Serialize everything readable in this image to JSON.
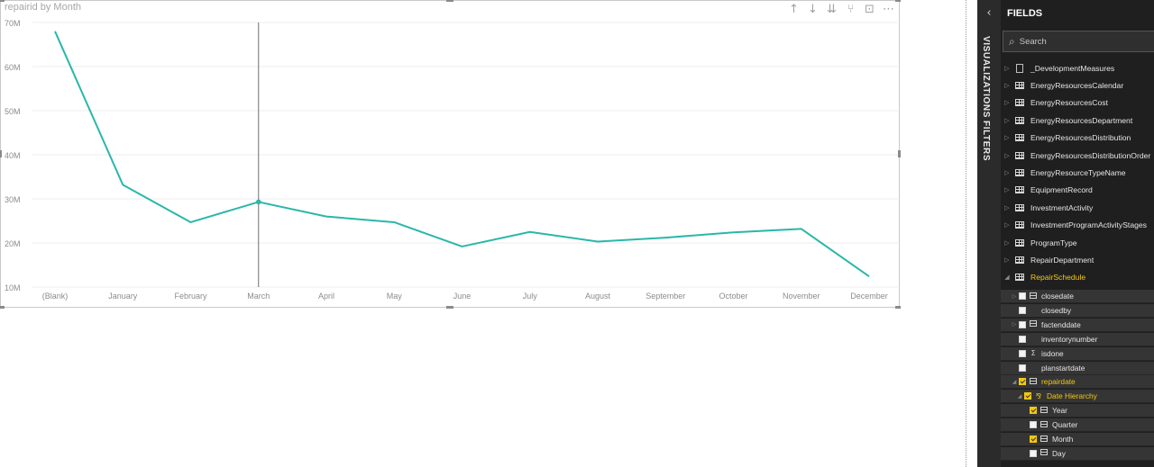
{
  "visual": {
    "title": "repairid by Month",
    "toolbar": [
      "↑",
      "↓",
      "⇊",
      "⑂",
      "⊡",
      "⋯"
    ]
  },
  "chart_data": {
    "type": "line",
    "title": "repairid by Month",
    "categories": [
      "(Blank)",
      "January",
      "February",
      "March",
      "April",
      "May",
      "June",
      "July",
      "August",
      "September",
      "October",
      "November",
      "December"
    ],
    "values": [
      68.0,
      33.2,
      24.7,
      29.3,
      26.0,
      24.7,
      19.2,
      22.5,
      20.3,
      21.2,
      22.4,
      23.2,
      12.4
    ],
    "yticks": [
      "10M",
      "20M",
      "30M",
      "40M",
      "50M",
      "60M",
      "70M"
    ],
    "ylim": [
      10,
      70
    ],
    "grid": true,
    "highlight_category": "March",
    "line_color": "#2ab7a9"
  },
  "pane": {
    "collapse_icon": "‹",
    "tabs": [
      "VISUALIZATIONS",
      "FILTERS"
    ],
    "fields_header": "FIELDS",
    "search_placeholder": "Search",
    "tables": [
      {
        "label": "_DevelopmentMeasures",
        "kind": "measure"
      },
      {
        "label": "EnergyResourcesCalendar",
        "kind": "table"
      },
      {
        "label": "EnergyResourcesCost",
        "kind": "table"
      },
      {
        "label": "EnergyResourcesDepartment",
        "kind": "table"
      },
      {
        "label": "EnergyResourcesDistribution",
        "kind": "table"
      },
      {
        "label": "EnergyResourcesDistributionOrder",
        "kind": "table"
      },
      {
        "label": "EnergyResourceTypeName",
        "kind": "table"
      },
      {
        "label": "EquipmentRecord",
        "kind": "table"
      },
      {
        "label": "InvestmentActivity",
        "kind": "table"
      },
      {
        "label": "InvestmentProgramActivityStages",
        "kind": "table"
      },
      {
        "label": "ProgramType",
        "kind": "table"
      },
      {
        "label": "RepairDepartment",
        "kind": "table"
      },
      {
        "label": "RepairSchedule",
        "kind": "table",
        "active": true
      }
    ],
    "fields": [
      {
        "label": "closedate",
        "checked": false,
        "icon": "calendar",
        "expandable": true,
        "indent": 0
      },
      {
        "label": "closedby",
        "checked": false,
        "icon": "",
        "indent": 0
      },
      {
        "label": "factenddate",
        "checked": false,
        "icon": "calendar",
        "expandable": true,
        "indent": 0
      },
      {
        "label": "inventorynumber",
        "checked": false,
        "icon": "",
        "indent": 0
      },
      {
        "label": "isdone",
        "checked": false,
        "icon": "Σ",
        "indent": 0
      },
      {
        "label": "planstartdate",
        "checked": false,
        "icon": "",
        "indent": 0
      },
      {
        "label": "repairdate",
        "checked": true,
        "icon": "calendar",
        "expandable": true,
        "expanded": true,
        "indent": 0,
        "active": true
      },
      {
        "label": "Date Hierarchy",
        "checked": true,
        "icon": "hierarchy",
        "expandable": true,
        "expanded": true,
        "indent": 1,
        "active": true
      },
      {
        "label": "Year",
        "checked": true,
        "icon": "calendar",
        "indent": 2
      },
      {
        "label": "Quarter",
        "checked": false,
        "icon": "calendar",
        "indent": 2
      },
      {
        "label": "Month",
        "checked": true,
        "icon": "calendar",
        "indent": 2
      },
      {
        "label": "Day",
        "checked": false,
        "icon": "calendar",
        "indent": 2
      }
    ]
  }
}
